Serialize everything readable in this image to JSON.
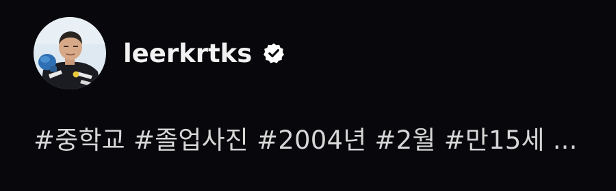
{
  "profile": {
    "username": "leerkrtks",
    "verified_icon": "verified-badge-icon",
    "avatar_icon": "profile-photo-avatar"
  },
  "caption": {
    "hashtags": [
      "#중학교",
      "#졸업사진",
      "#2004년",
      "#2월",
      "#만15세"
    ],
    "more": "..."
  },
  "colors": {
    "background": "#08080c",
    "username": "#f2f2f2",
    "caption": "#d6d6d6",
    "verified_badge": "#ffffff"
  }
}
